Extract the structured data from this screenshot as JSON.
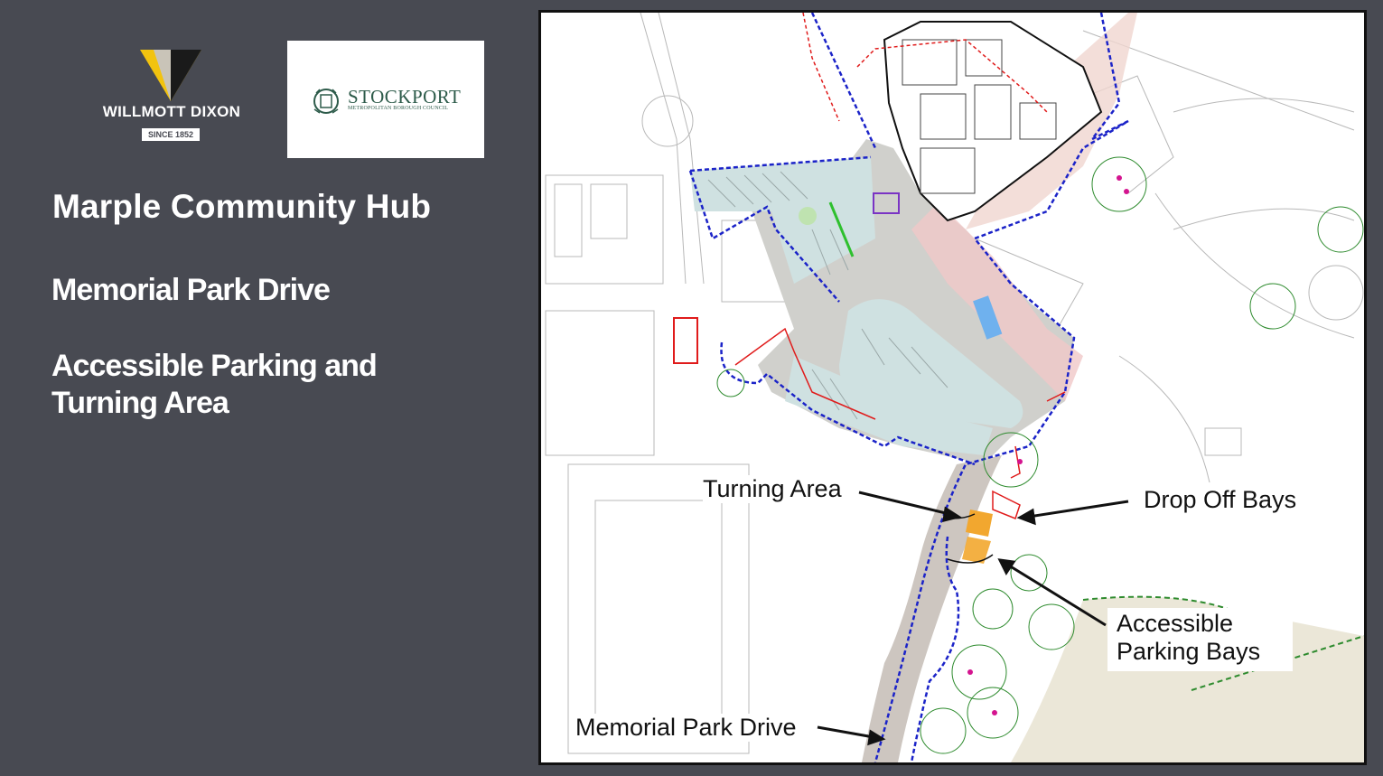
{
  "logos": {
    "willmott_dixon": {
      "name": "WILLMOTT DIXON",
      "since": "SINCE 1852",
      "brand_color": "#f2c30f"
    },
    "stockport": {
      "name": "STOCKPORT",
      "subtitle": "METROPOLITAN BOROUGH COUNCIL",
      "brand_color": "#2d5b4a"
    }
  },
  "title": "Marple Community Hub",
  "subtitle_1": "Memorial Park Drive",
  "subtitle_2": "Accessible Parking and Turning Area",
  "map": {
    "callouts": {
      "turning_area": "Turning Area",
      "drop_off_bays": "Drop Off Bays",
      "accessible_parking_bays": "Accessible Parking Bays",
      "memorial_park_drive": "Memorial Park Drive"
    },
    "colors": {
      "site_boundary": "#1b23c8",
      "red_line": "#e01b1b",
      "green_boundary": "#2e8b2e",
      "parking_fill": "#cfe1e1",
      "road_fill": "#cdc6c0",
      "park_fill": "#ebe7d8",
      "accessible_bays": "#f2a72f"
    }
  },
  "background_color": "#484a52"
}
